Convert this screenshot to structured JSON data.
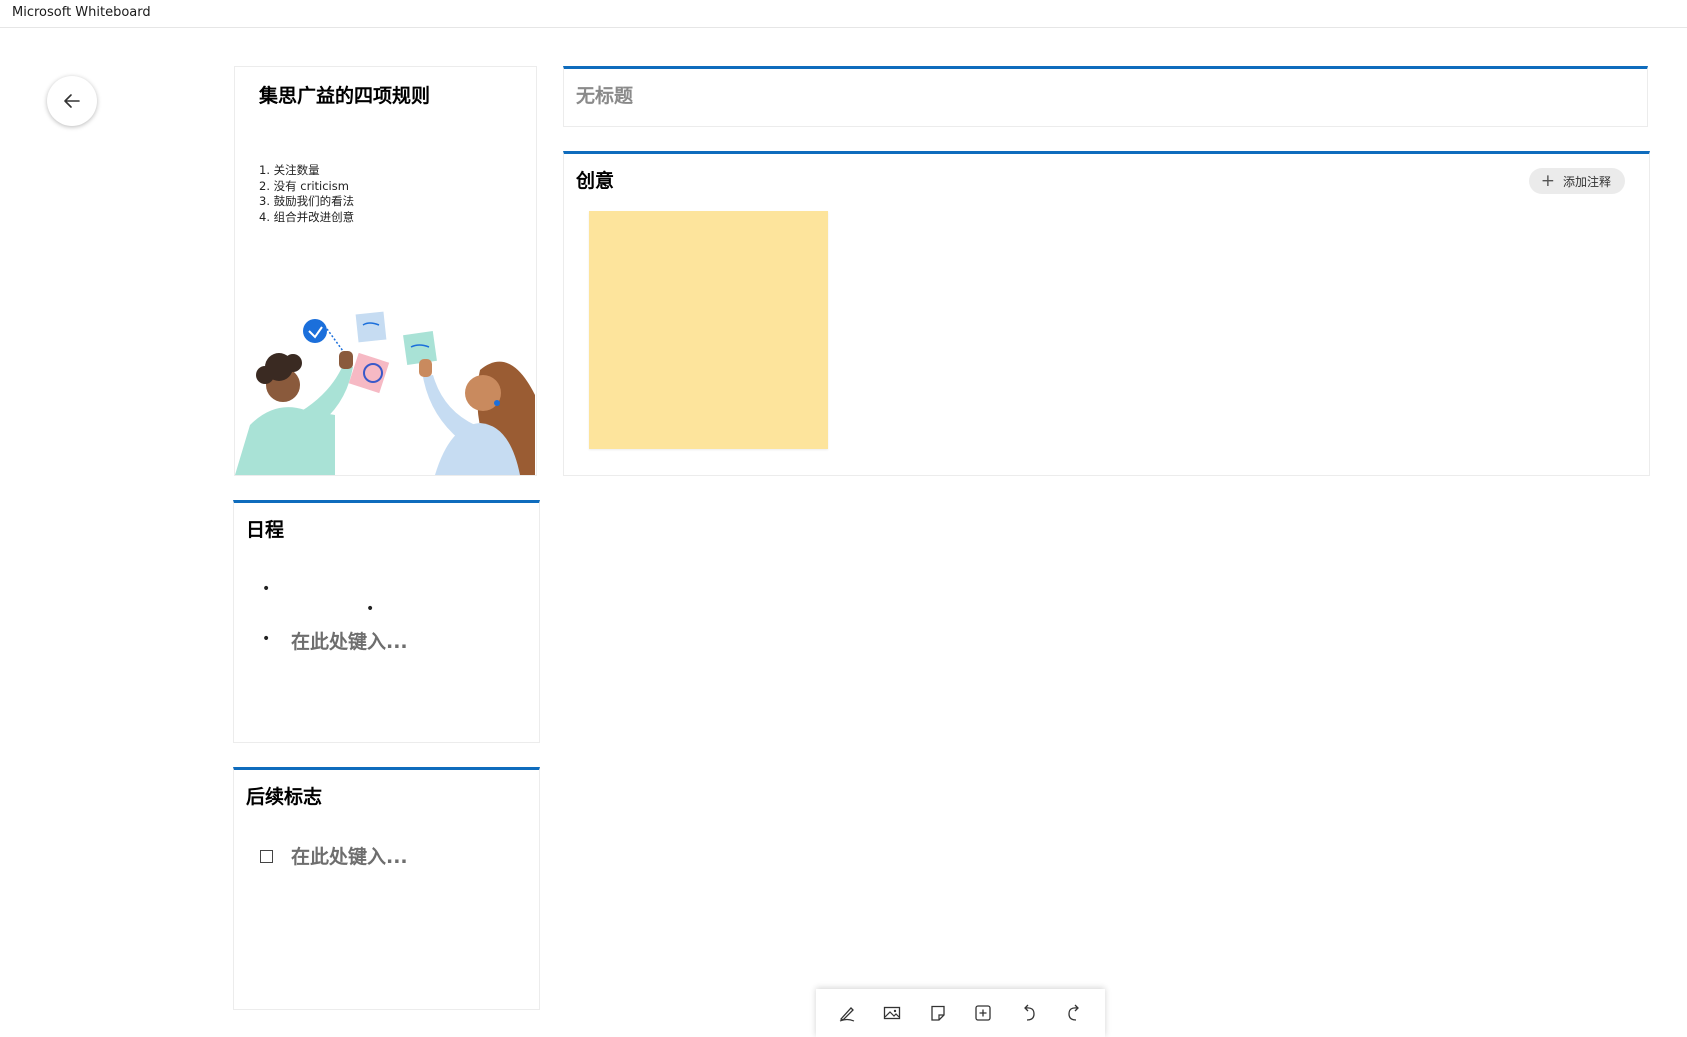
{
  "window": {
    "title": "Microsoft Whiteboard"
  },
  "nav": {
    "back_icon": "arrow-left-icon"
  },
  "rules_card": {
    "title": "集思广益的四项规则",
    "items": [
      "1. 关注数量",
      "2. 没有 criticism",
      "3. 鼓励我们的看法",
      "4. 组合并改进创意"
    ]
  },
  "title_card": {
    "placeholder": "无标题"
  },
  "ideas_card": {
    "title": "创意",
    "add_note_label": "添加注释",
    "sticky_color": "#fde49c"
  },
  "agenda_card": {
    "title": "日程",
    "type_here": "在此处键入..."
  },
  "followup_card": {
    "title": "后续标志",
    "type_here": "在此处键入..."
  },
  "toolbar": {
    "tools": [
      "pen-icon",
      "image-icon",
      "sticky-note-icon",
      "add-icon",
      "undo-icon",
      "redo-icon"
    ]
  },
  "accent_color": "#0f6cbd"
}
